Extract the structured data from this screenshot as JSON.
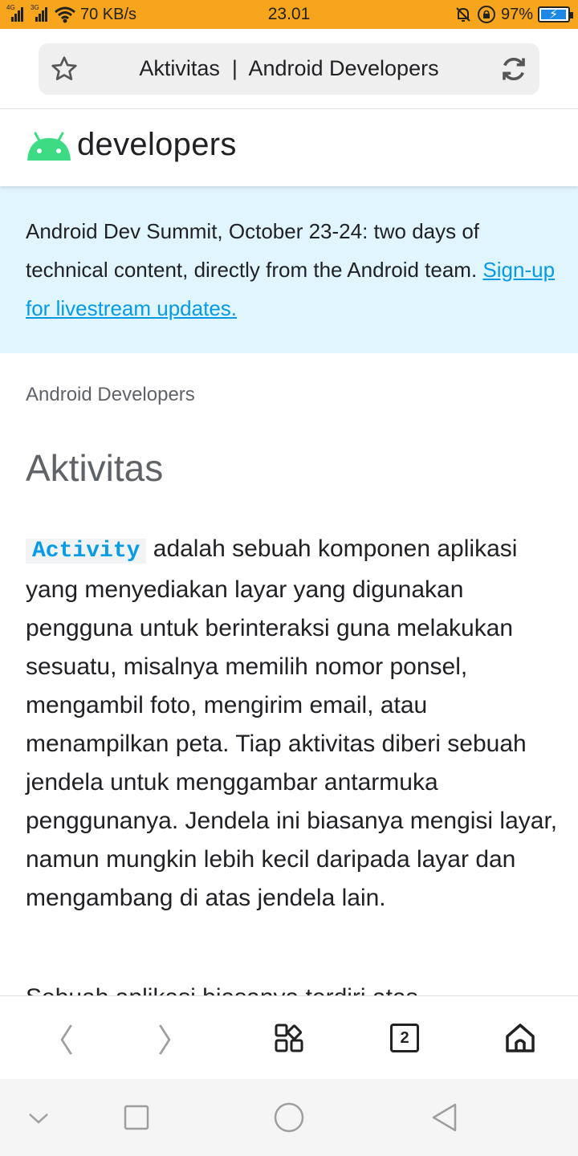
{
  "status_bar": {
    "network_1": "4G",
    "network_2": "3G",
    "speed": "70 KB/s",
    "time": "23.01",
    "battery": "97%",
    "battery_level": 0.97,
    "icons": [
      "signal-icon",
      "wifi-icon",
      "mute-icon",
      "rotation-lock-icon",
      "battery-charging-icon"
    ]
  },
  "address_bar": {
    "title": "Aktivitas  |  Android Developers",
    "icons": [
      "star-icon",
      "refresh-icon"
    ]
  },
  "site_header": {
    "logo_text": "developers",
    "logo_color": "#3ddc84"
  },
  "banner": {
    "text": "Android Dev Summit, October 23-24: two days of technical content, directly from the Android team. ",
    "link": "Sign-up for livestream updates.",
    "background": "#e1f5fe",
    "link_color": "#039be5"
  },
  "breadcrumb": "Android Developers",
  "page_title": "Aktivitas",
  "content": {
    "code_term": "Activity",
    "paragraph": " adalah sebuah komponen aplikasi yang menyediakan layar yang digunakan pengguna untuk berinteraksi guna melakukan sesuatu, misalnya memilih nomor ponsel, mengambil foto, mengirim email, atau menampilkan peta. Tiap aktivitas diberi sebuah jendela untuk menggambar antarmuka penggunanya. Jendela ini biasanya mengisi layar, namun mungkin lebih kecil daripada layar dan mengambang di atas jendela lain.",
    "next_line_partial": "Sebuah aplikasi biasanya terdiri atas"
  },
  "toolbar": {
    "back": "〈",
    "forward": "〉",
    "tab_count": "2",
    "icons": [
      "back-icon",
      "forward-icon",
      "menu-grid-icon",
      "tabs-icon",
      "home-icon"
    ]
  },
  "navbar": {
    "icons": [
      "collapse-icon",
      "recents-icon",
      "home-nav-icon",
      "back-nav-icon"
    ]
  }
}
